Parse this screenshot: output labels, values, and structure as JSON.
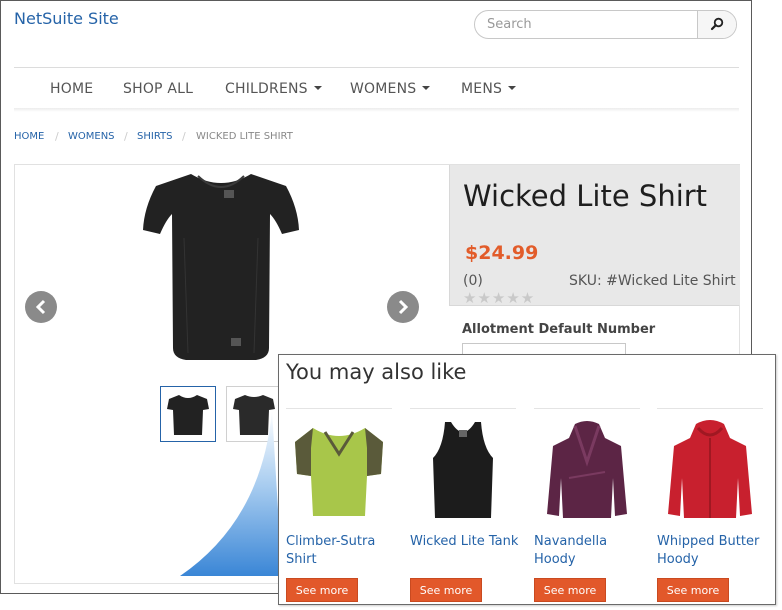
{
  "site": {
    "title": "NetSuite Site"
  },
  "search": {
    "placeholder": "Search"
  },
  "nav": {
    "items": [
      {
        "label": "HOME",
        "dropdown": false
      },
      {
        "label": "SHOP ALL",
        "dropdown": false
      },
      {
        "label": "CHILDRENS",
        "dropdown": true
      },
      {
        "label": "WOMENS",
        "dropdown": true
      },
      {
        "label": "MENS",
        "dropdown": true
      }
    ]
  },
  "breadcrumb": [
    "HOME",
    "WOMENS",
    "SHIRTS",
    "WICKED LITE SHIRT"
  ],
  "product": {
    "title": "Wicked Lite Shirt",
    "price": "$24.99",
    "reviews": "(0)",
    "sku": "SKU: #Wicked Lite Shirt",
    "rating": 0,
    "rating_max": 5,
    "stars": "★★★★★",
    "option_label": "Allotment Default Number",
    "option_value": ""
  },
  "recommendations": {
    "title": "You may also like",
    "items": [
      {
        "name": "Climber-Sutra Shirt",
        "button": "See more",
        "color": "#a8c64a"
      },
      {
        "name": "Wicked Lite Tank",
        "button": "See more",
        "color": "#1c1c1c"
      },
      {
        "name": "Navandella Hoody",
        "button": "See more",
        "color": "#5c2545"
      },
      {
        "name": "Whipped Butter Hoody",
        "button": "See more",
        "color": "#c8202e"
      }
    ]
  },
  "colors": {
    "link": "#2563a8",
    "price": "#e25c2a",
    "button": "#e2582a",
    "callout": "#4a90d9"
  }
}
